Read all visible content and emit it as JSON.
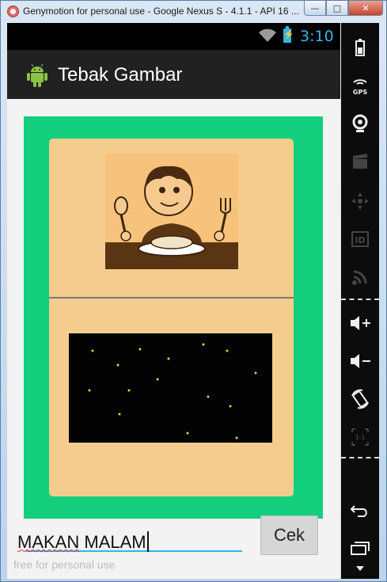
{
  "window": {
    "title": "Genymotion for personal use - Google Nexus S - 4.1.1 - API 16 ...",
    "minimize_glyph": "—",
    "maximize_glyph": "□",
    "close_glyph": "✕"
  },
  "statusbar": {
    "battery_glyph": "⚡",
    "time": "3:10"
  },
  "app": {
    "title": "Tebak Gambar",
    "answer_value_part1": "MAKAN",
    "answer_value_part2": " MALAM",
    "check_button": "Cek",
    "watermark": "free for personal use"
  },
  "colors": {
    "green_bg": "#13cf7d",
    "card_bg": "#f4cd8e",
    "accent": "#33b5e5"
  },
  "side_tools": [
    "battery-icon",
    "gps-icon",
    "webcam-icon",
    "video-capture-icon",
    "dpad-icon",
    "id-icon",
    "cast-icon",
    "volume-up-icon",
    "volume-down-icon",
    "rotate-icon",
    "pixel-perfect-icon",
    "back-icon",
    "recent-apps-icon"
  ],
  "side_labels": {
    "gps": "GPS",
    "id": "ID",
    "pixel": "1:1"
  }
}
